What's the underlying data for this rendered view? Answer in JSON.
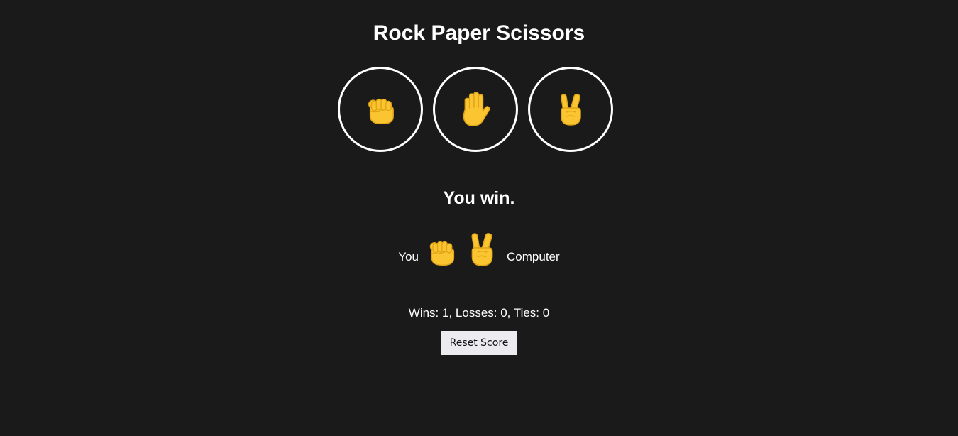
{
  "game": {
    "title": "Rock Paper Scissors"
  },
  "choices": [
    {
      "name": "rock",
      "icon": "raised-fist-icon"
    },
    {
      "name": "paper",
      "icon": "raised-hand-icon"
    },
    {
      "name": "scissors",
      "icon": "victory-hand-icon"
    }
  ],
  "result": {
    "text": "You win.",
    "player_label": "You",
    "player_move_icon": "raised-fist-icon",
    "computer_move_icon": "victory-hand-icon",
    "computer_label": "Computer"
  },
  "score": {
    "text": "Wins: 1, Losses: 0, Ties: 0"
  },
  "reset": {
    "label": "Reset Score"
  },
  "colors": {
    "background": "#1a1a1a",
    "text": "#ffffff",
    "emoji_yellow": "#fbc531",
    "emoji_shade": "#e0a516",
    "button_bg": "#ececf0"
  }
}
